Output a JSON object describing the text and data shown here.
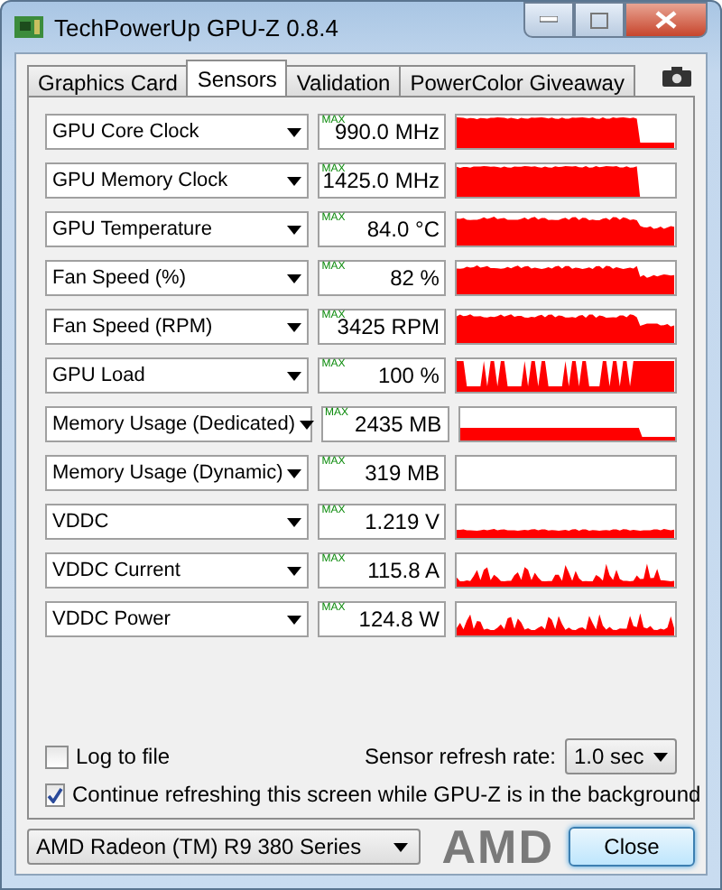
{
  "window": {
    "title": "TechPowerUp GPU-Z 0.8.4"
  },
  "tabs": [
    {
      "label": "Graphics Card",
      "selected": false
    },
    {
      "label": "Sensors",
      "selected": true
    },
    {
      "label": "Validation",
      "selected": false
    },
    {
      "label": "PowerColor Giveaway",
      "selected": false
    }
  ],
  "sensors": [
    {
      "name": "GPU Core Clock",
      "max_tag": "MAX",
      "reading": "990.0 MHz",
      "kind": "drop"
    },
    {
      "name": "GPU Memory Clock",
      "max_tag": "MAX",
      "reading": "1425.0 MHz",
      "kind": "drop"
    },
    {
      "name": "GPU Temperature",
      "max_tag": "MAX",
      "reading": "84.0 °C",
      "kind": "plateau"
    },
    {
      "name": "Fan Speed (%)",
      "max_tag": "MAX",
      "reading": "82 %",
      "kind": "plateau"
    },
    {
      "name": "Fan Speed (RPM)",
      "max_tag": "MAX",
      "reading": "3425 RPM",
      "kind": "plateau"
    },
    {
      "name": "GPU Load",
      "max_tag": "MAX",
      "reading": "100 %",
      "kind": "spikes"
    },
    {
      "name": "Memory Usage (Dedicated)",
      "max_tag": "MAX",
      "reading": "2435 MB",
      "kind": "step"
    },
    {
      "name": "Memory Usage (Dynamic)",
      "max_tag": "MAX",
      "reading": "319 MB",
      "kind": "low"
    },
    {
      "name": "VDDC",
      "max_tag": "MAX",
      "reading": "1.219 V",
      "kind": "band"
    },
    {
      "name": "VDDC Current",
      "max_tag": "MAX",
      "reading": "115.8 A",
      "kind": "noise"
    },
    {
      "name": "VDDC Power",
      "max_tag": "MAX",
      "reading": "124.8 W",
      "kind": "noise"
    }
  ],
  "log_to_file": {
    "label": "Log to file",
    "checked": false
  },
  "refresh_rate": {
    "label": "Sensor refresh rate:",
    "value": "1.0 sec"
  },
  "background_refresh": {
    "label": "Continue refreshing this screen while GPU-Z is in the background",
    "checked": true
  },
  "gpu_select": {
    "value": "AMD Radeon (TM) R9 380 Series"
  },
  "logo": "AMD",
  "close_button": "Close"
}
